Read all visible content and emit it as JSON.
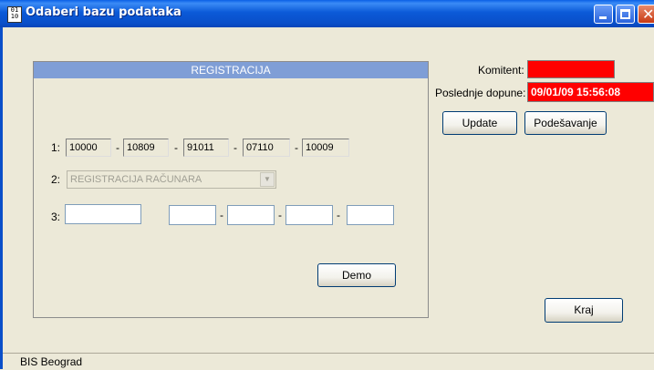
{
  "window": {
    "title": "Odaberi bazu podataka",
    "icon": "database-icon",
    "controls": {
      "minimize": "minimize-icon",
      "maximize": "maximize-icon",
      "close": "close-icon"
    },
    "title_gradient_color": "#0a5fe6",
    "close_color": "#c83a13"
  },
  "registration": {
    "header": "REGISTRACIJA",
    "header_color": "#7f9ed6",
    "row1": {
      "label": "1:",
      "fields": [
        "10000",
        "10809",
        "91011",
        "07110",
        "10009"
      ],
      "separator": "-"
    },
    "row2": {
      "label": "2:",
      "select_value": "REGISTRACIJA RAČUNARA"
    },
    "row3": {
      "label": "3:",
      "main_value": "",
      "fields": [
        "",
        "",
        "",
        ""
      ],
      "separator": "-"
    },
    "demo_button": "Demo"
  },
  "info": {
    "komitent_label": "Komitent:",
    "komitent_value": "",
    "poslednje_label": "Poslednje dopune:",
    "poslednje_value": "09/01/09 15:56:08",
    "highlight_color": "#ff0000"
  },
  "buttons": {
    "update": "Update",
    "podesavanje": "Podešavanje",
    "kraj": "Kraj"
  },
  "statusbar": {
    "text": "BIS Beograd"
  }
}
